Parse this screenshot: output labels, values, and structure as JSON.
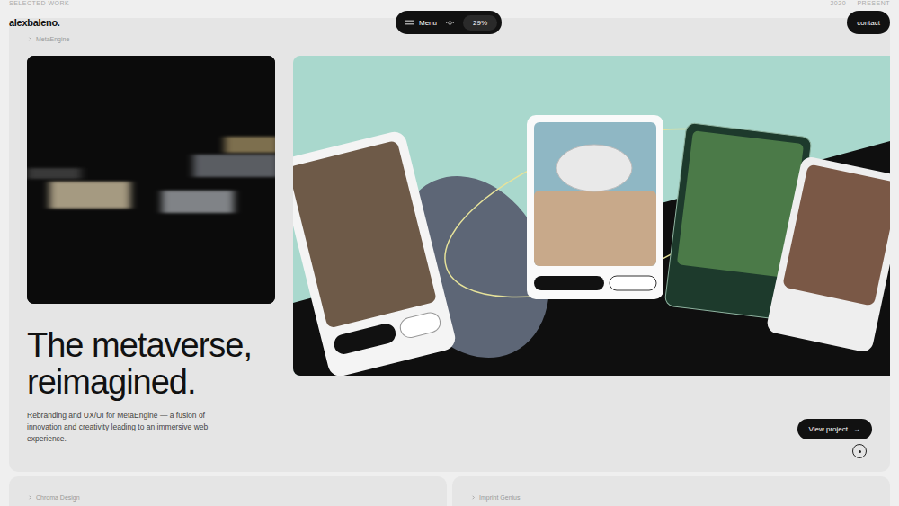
{
  "section": {
    "label": "SELECTED WORK",
    "years": "2020 — PRESENT"
  },
  "nav": {
    "logo": "alexbaleno.",
    "menu": "Menu",
    "progress": "29%",
    "contact": "contact"
  },
  "project": {
    "tag": "MetaEngine",
    "title_lines": [
      "The metaverse,",
      "reimagined."
    ],
    "description": "Rebranding and UX/UI for MetaEngine — a fusion of innovation and creativity leading to an immersive web experience.",
    "cta": "View project",
    "cta_icon": "→"
  },
  "more_projects": [
    {
      "tag": "Chroma Design"
    },
    {
      "tag": "Imprint Genius"
    }
  ]
}
